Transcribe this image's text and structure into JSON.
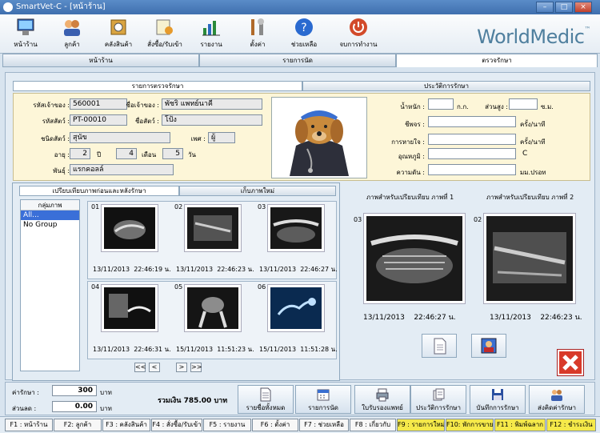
{
  "window": {
    "title": "SmartVet-C - [หน้าร้าน]"
  },
  "toolbar": {
    "items": [
      {
        "label": "หน้าร้าน",
        "icon": "monitor-icon"
      },
      {
        "label": "ลูกค้า",
        "icon": "customers-icon"
      },
      {
        "label": "คลังสินค้า",
        "icon": "warehouse-icon"
      },
      {
        "label": "สั่งซื้อ/รับเข้า",
        "icon": "purchase-icon"
      },
      {
        "label": "รายงาน",
        "icon": "report-chart-icon"
      },
      {
        "label": "ตั้งค่า",
        "icon": "settings-tools-icon"
      },
      {
        "label": "ช่วยเหลือ",
        "icon": "help-icon"
      },
      {
        "label": "จบการทำงาน",
        "icon": "power-icon"
      }
    ],
    "logo": "WorldMedic"
  },
  "main_tabs": [
    "หน้าร้าน",
    "รายการนัด",
    "ตรวจรักษา"
  ],
  "sub_tabs": [
    "รายการตรวจรักษา",
    "ประวัติการรักษา"
  ],
  "patient": {
    "owner_code_label": "รหัสเจ้าของ :",
    "owner_code": "560001",
    "owner_name_label": "ชื่อเจ้าของ :",
    "owner_name": "พัชริ แพทย์นาคี",
    "pet_code_label": "รหัสสัตว์ :",
    "pet_code": "PT-00010",
    "pet_name_label": "ชื่อสัตว์ :",
    "pet_name": "โป้ง",
    "species_label": "ชนิดสัตว์ :",
    "species": "สุนัข",
    "sex_label": "เพศ :",
    "sex": "ผู้",
    "age_label": "อายุ :",
    "age_years": "2",
    "years_unit": "ปี",
    "age_months": "4",
    "months_unit": "เดือน",
    "age_days": "5",
    "days_unit": "วัน",
    "breed_label": "พันธุ์ :",
    "breed": "แรกคอลล์"
  },
  "vitals": {
    "weight_label": "น้ำหนัก :",
    "weight": "",
    "weight_unit": "ก.ก.",
    "height_label": "ส่วนสูง :",
    "height": "",
    "height_unit": "ซ.ม.",
    "pulse_label": "ชีพจร :",
    "pulse": "",
    "pulse_unit": "ครั้ง/นาที",
    "resp_label": "การหายใจ :",
    "resp": "",
    "resp_unit": "ครั้ง/นาที",
    "temp_label": "อุณหภูมิ :",
    "temp": "",
    "temp_unit": "C",
    "bp_label": "ความดัน :",
    "bp": "",
    "bp_unit": "มม.ปรอท"
  },
  "image_tabs": [
    "เปรียบเทียบภาพก่อนและหลังรักษา",
    "เก็บภาพใหม่"
  ],
  "groups": {
    "header": "กลุ่มภาพ",
    "items": [
      "All...",
      "No Group"
    ]
  },
  "thumbnails": [
    {
      "no": "01",
      "date": "13/11/2013",
      "time": "22:46:19 น."
    },
    {
      "no": "02",
      "date": "13/11/2013",
      "time": "22:46:23 น."
    },
    {
      "no": "03",
      "date": "13/11/2013",
      "time": "22:46:27 น."
    },
    {
      "no": "04",
      "date": "13/11/2013",
      "time": "22:46:31 น."
    },
    {
      "no": "05",
      "date": "15/11/2013",
      "time": "11:51:23 น."
    },
    {
      "no": "06",
      "date": "15/11/2013",
      "time": "11:51:28 น."
    }
  ],
  "pager": [
    "<<",
    "<",
    ">",
    ">>"
  ],
  "compare": {
    "header1": "ภาพสำหรับเปรียบเทียบ ภาพที่ 1",
    "header2": "ภาพสำหรับเปรียบเทียบ ภาพที่ 2",
    "img1": {
      "no": "03",
      "date": "13/11/2013",
      "time": "22:46:27 น."
    },
    "img2": {
      "no": "02",
      "date": "13/11/2013",
      "time": "22:46:23 น."
    }
  },
  "billing": {
    "fee_label": "ค่ารักษา :",
    "fee": "300",
    "fee_unit": "บาท",
    "discount_label": "ส่วนลด :",
    "discount": "0.00",
    "discount_unit": "บาท",
    "total": "รวมเงิน 785.00 บาท"
  },
  "actions": [
    "รายชื่อทั้งหมด",
    "รายการนัด",
    "ใบรับรองแพทย์",
    "ประวัติการรักษา",
    "บันทึกการรักษา",
    "ส่งคิดค่ารักษา"
  ],
  "fkeys": [
    {
      "label": "F1 : หน้าร้าน",
      "hl": false
    },
    {
      "label": "F2: ลูกค้า",
      "hl": false
    },
    {
      "label": "F3 : คลังสินค้า",
      "hl": false
    },
    {
      "label": "F4 : สั่งซื้อ/รับเข้า",
      "hl": false
    },
    {
      "label": "F5 : รายงาน",
      "hl": false
    },
    {
      "label": "F6 : ตั้งค่า",
      "hl": false
    },
    {
      "label": "F7 : ช่วยเหลือ",
      "hl": false
    },
    {
      "label": "F8 : เกี่ยวกับ",
      "hl": false
    },
    {
      "label": "F9 : รายการใหม่",
      "hl": true
    },
    {
      "label": "F10: พักการขาย",
      "hl": true
    },
    {
      "label": "F11 : พิมพ์ฉลาก",
      "hl": true
    },
    {
      "label": "F12 : ชำระเงิน",
      "hl": true
    }
  ]
}
